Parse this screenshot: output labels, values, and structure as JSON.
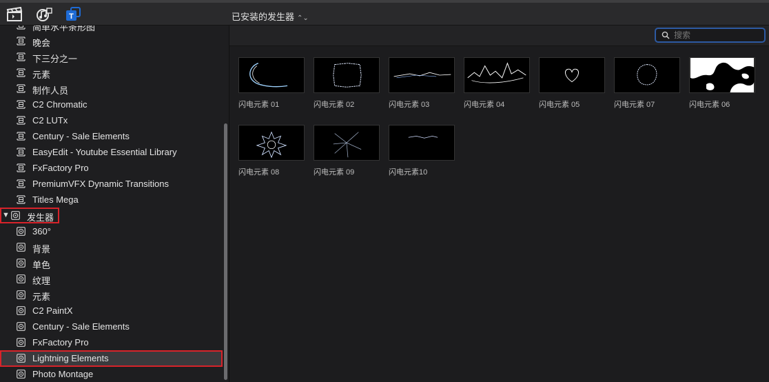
{
  "toolbar": {
    "library_title": "已安装的发生器",
    "updown_glyph": "⌃⌄"
  },
  "sidebar": {
    "title_items": [
      "简单水平条形图",
      "晚会",
      "下三分之一",
      "元素",
      "制作人员",
      "C2 Chromatic",
      "C2 LUTx",
      "Century - Sale Elements",
      "EasyEdit - Youtube Essential Library",
      "FxFactory Pro",
      "PremiumVFX Dynamic Transitions",
      "Titles Mega"
    ],
    "generators_header": "发生器",
    "generator_items": [
      "360°",
      "背景",
      "单色",
      "纹理",
      "元素",
      "C2 PaintX",
      "Century - Sale Elements",
      "FxFactory Pro",
      "Lightning Elements",
      "Photo Montage"
    ],
    "selected_item": "Lightning Elements"
  },
  "search": {
    "placeholder": "搜索",
    "value": ""
  },
  "browser": {
    "items": [
      {
        "label": "闪电元素 01"
      },
      {
        "label": "闪电元素 02"
      },
      {
        "label": "闪电元素 03"
      },
      {
        "label": "闪电元素 04"
      },
      {
        "label": "闪电元素 05"
      },
      {
        "label": "闪电元素 07"
      },
      {
        "label": "闪电元素 06"
      },
      {
        "label": "闪电元素 08"
      },
      {
        "label": "闪电元素 09"
      },
      {
        "label": "闪电元素10"
      }
    ]
  },
  "colors": {
    "highlight_outline": "#d8232a",
    "search_focus": "#2d5aa3",
    "titles_icon": "#1e6bd6"
  }
}
